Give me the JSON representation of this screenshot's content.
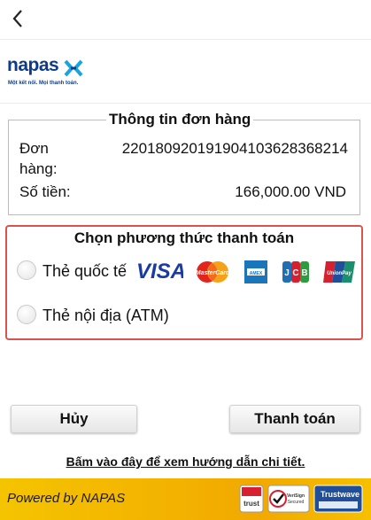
{
  "header": {
    "back_icon": "chevron-left-icon"
  },
  "brand": {
    "name": "napas",
    "tagline": "Một kết nối. Mọi thanh toán."
  },
  "order": {
    "title": "Thông tin đơn hàng",
    "order_label_line1": "Đơn",
    "order_label_line2": "hàng:",
    "order_id": "22018092019190410362836821​4",
    "amount_label": "Số tiền:",
    "amount_value": "166,000.00 VND"
  },
  "payment": {
    "title": "Chọn phương thức thanh toán",
    "options": [
      {
        "label": "Thẻ quốc tế",
        "selected": false,
        "cards": [
          "VISA",
          "MasterCard",
          "AMERICAN EXPRESS",
          "JCB",
          "UnionPay"
        ]
      },
      {
        "label": "Thẻ nội địa (ATM)",
        "selected": false
      }
    ],
    "accent_color": "#d9534f"
  },
  "actions": {
    "cancel_label": "Hủy",
    "pay_label": "Thanh toán"
  },
  "guide_link": "Bấm vào đây để xem hướng dẫn chi tiết.",
  "footer": {
    "powered_by": "Powered by NAPAS",
    "badges": [
      "trust",
      "VeriSign Secured",
      "Trustwave"
    ]
  }
}
